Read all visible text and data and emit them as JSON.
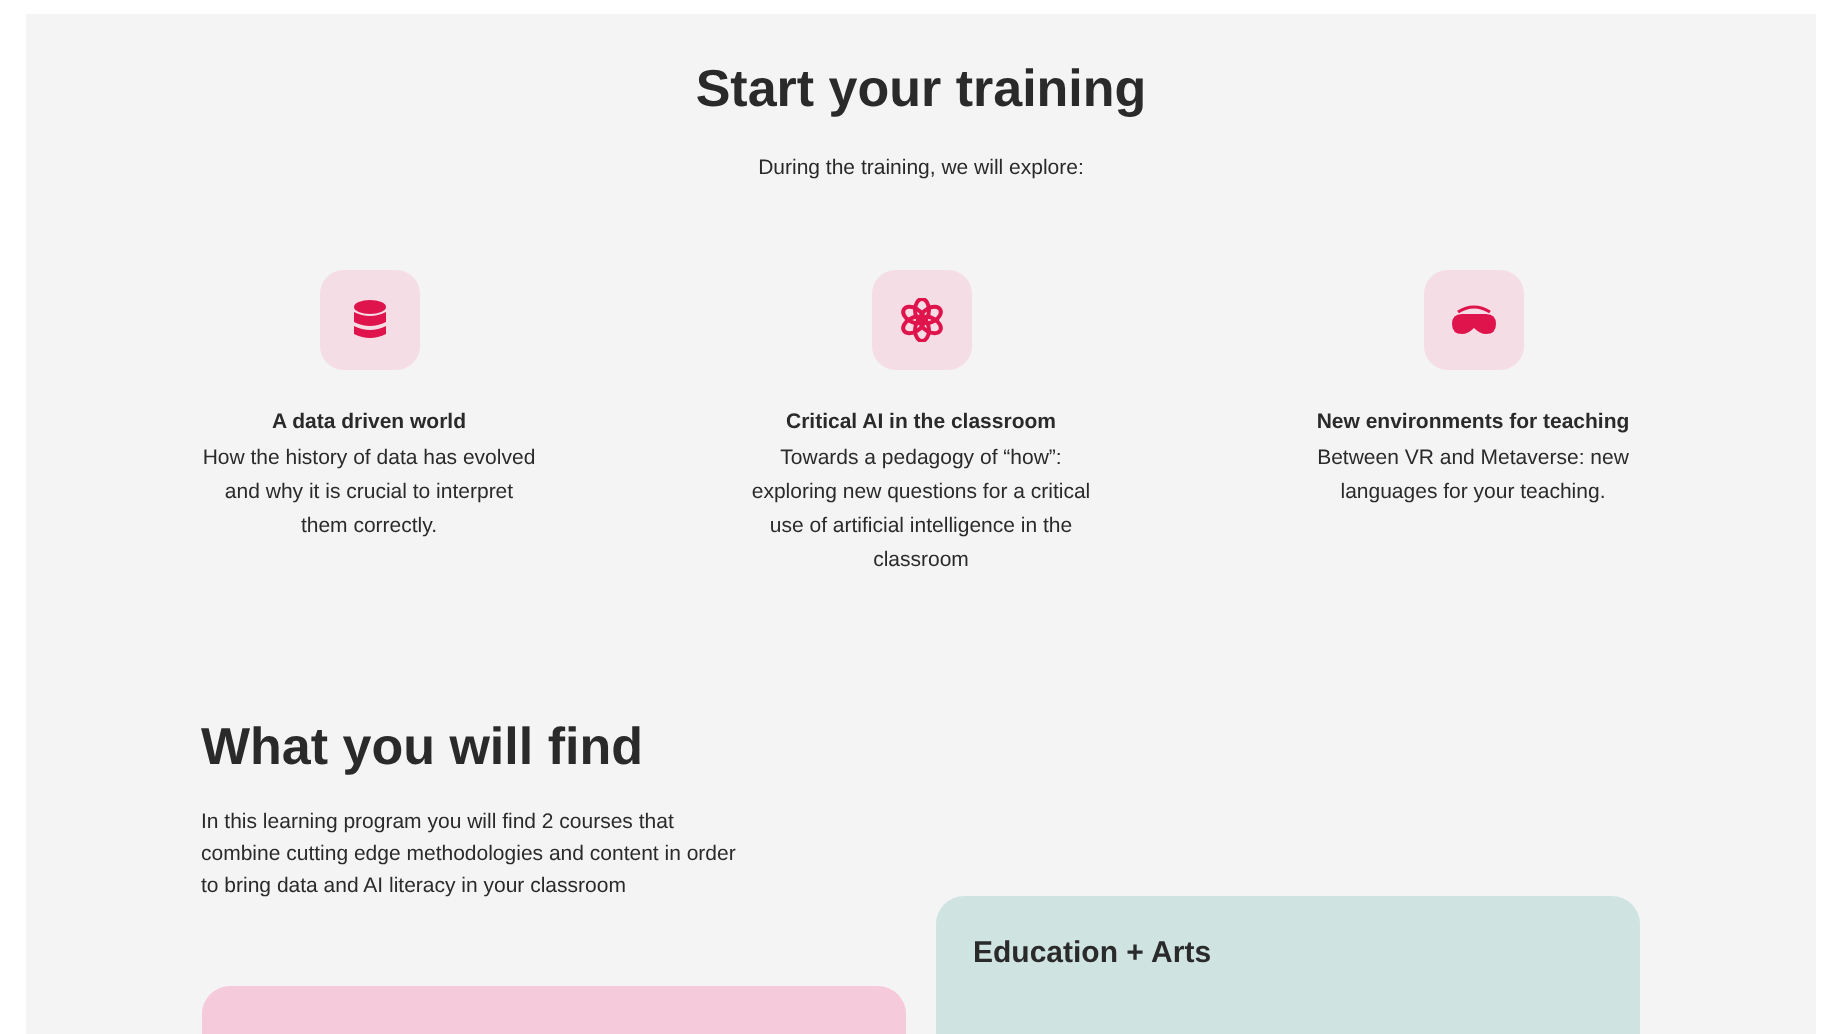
{
  "header": {
    "title": "Start your training",
    "subtitle": "During the training, we will explore:"
  },
  "topics": [
    {
      "title": "A data driven world",
      "description": "How the history of data has evolved and why it is crucial to interpret them correctly."
    },
    {
      "title": "Critical AI in the classroom",
      "description": "Towards a pedagogy of “how”: exploring new questions for a critical use of artificial intelligence in the classroom"
    },
    {
      "title": "New environments for teaching",
      "description": "Between VR and Metaverse: new languages for your teaching."
    }
  ],
  "find": {
    "title": "What you will find",
    "text": "In this learning program you will find 2 courses that combine cutting edge methodologies and content in order to bring data and AI literacy in your classroom"
  },
  "courses": [
    {
      "color": "#f5cadb"
    },
    {
      "title": "Education + Arts",
      "color": "#cfe4e1"
    }
  ]
}
